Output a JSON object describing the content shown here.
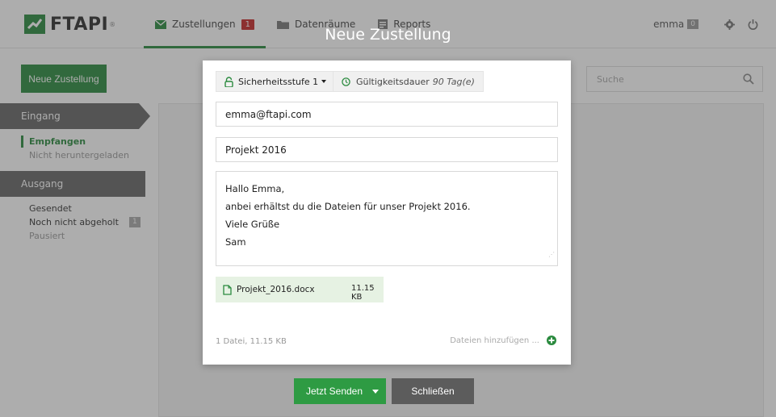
{
  "brand": {
    "logo_text": "FTAPI",
    "reg_mark": "®"
  },
  "nav": {
    "items": [
      {
        "label": "Zustellungen",
        "badge": "1",
        "icon": "envelope-icon"
      },
      {
        "label": "Datenräume",
        "icon": "folder-icon"
      },
      {
        "label": "Reports",
        "icon": "report-icon"
      }
    ]
  },
  "user": {
    "name": "emma",
    "badge": "0",
    "settings_icon": "gear-icon",
    "logout_icon": "power-icon"
  },
  "toolbar": {
    "new_delivery_label": "Neue Zustellung",
    "search_placeholder": "Suche",
    "search_icon": "search-icon"
  },
  "sidebar": {
    "inbox_header": "Eingang",
    "inbox_items": [
      {
        "label": "Empfangen"
      },
      {
        "label": "Nicht heruntergeladen"
      }
    ],
    "outbox_header": "Ausgang",
    "outbox_items": [
      {
        "label": "Gesendet"
      },
      {
        "label": "Noch nicht abgeholt",
        "count": "1"
      },
      {
        "label": "Pausiert"
      }
    ]
  },
  "modal": {
    "title": "Neue Zustellung",
    "security_label": "Sicherheitsstufe 1",
    "validity_label": "Gültigkeitsdauer",
    "validity_value": "90 Tag(e)",
    "recipient": "emma@ftapi.com",
    "subject": "Projekt 2016",
    "message_lines": [
      "Hallo Emma,",
      "anbei erhältst du die Dateien für unser Projekt 2016.",
      "Viele Grüße",
      "Sam"
    ],
    "file": {
      "name": "Projekt_2016.docx",
      "size": "11.15 KB"
    },
    "summary": "1 Datei, 11.15 KB",
    "add_files_label": "Dateien hinzufügen ..."
  },
  "actions": {
    "send_label": "Jetzt Senden",
    "close_label": "Schließen"
  },
  "colors": {
    "accent_green": "#2a8a3e",
    "badge_red": "#c62828",
    "file_chip_bg": "#e6f2e3"
  }
}
